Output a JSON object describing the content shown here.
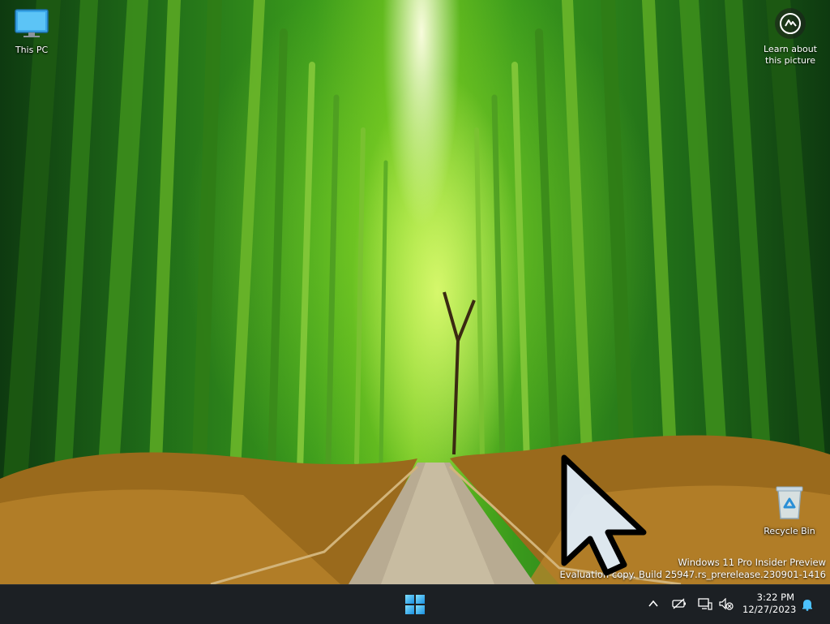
{
  "desktop": {
    "icons": [
      {
        "label": "This PC",
        "icon": "this-pc-icon"
      },
      {
        "label": "Recycle Bin",
        "icon": "recycle-bin-icon"
      }
    ],
    "spotlight": {
      "label_line1": "Learn about",
      "label_line2": "this picture"
    },
    "watermark": {
      "line1": "Windows 11 Pro Insider Preview",
      "line2": "Evaluation copy. Build 25947.rs_prerelease.230901-1416"
    }
  },
  "taskbar": {
    "start_icon": "windows-start-icon",
    "tray": {
      "icons": [
        "chevron-up-icon",
        "battery-icon",
        "network-icon",
        "volume-muted-icon",
        "notification-bell-icon"
      ],
      "time": "3:22 PM",
      "date": "12/27/2023"
    }
  },
  "colors": {
    "taskbar_bg": "#1c2024",
    "accent": "#4cc2ff"
  }
}
